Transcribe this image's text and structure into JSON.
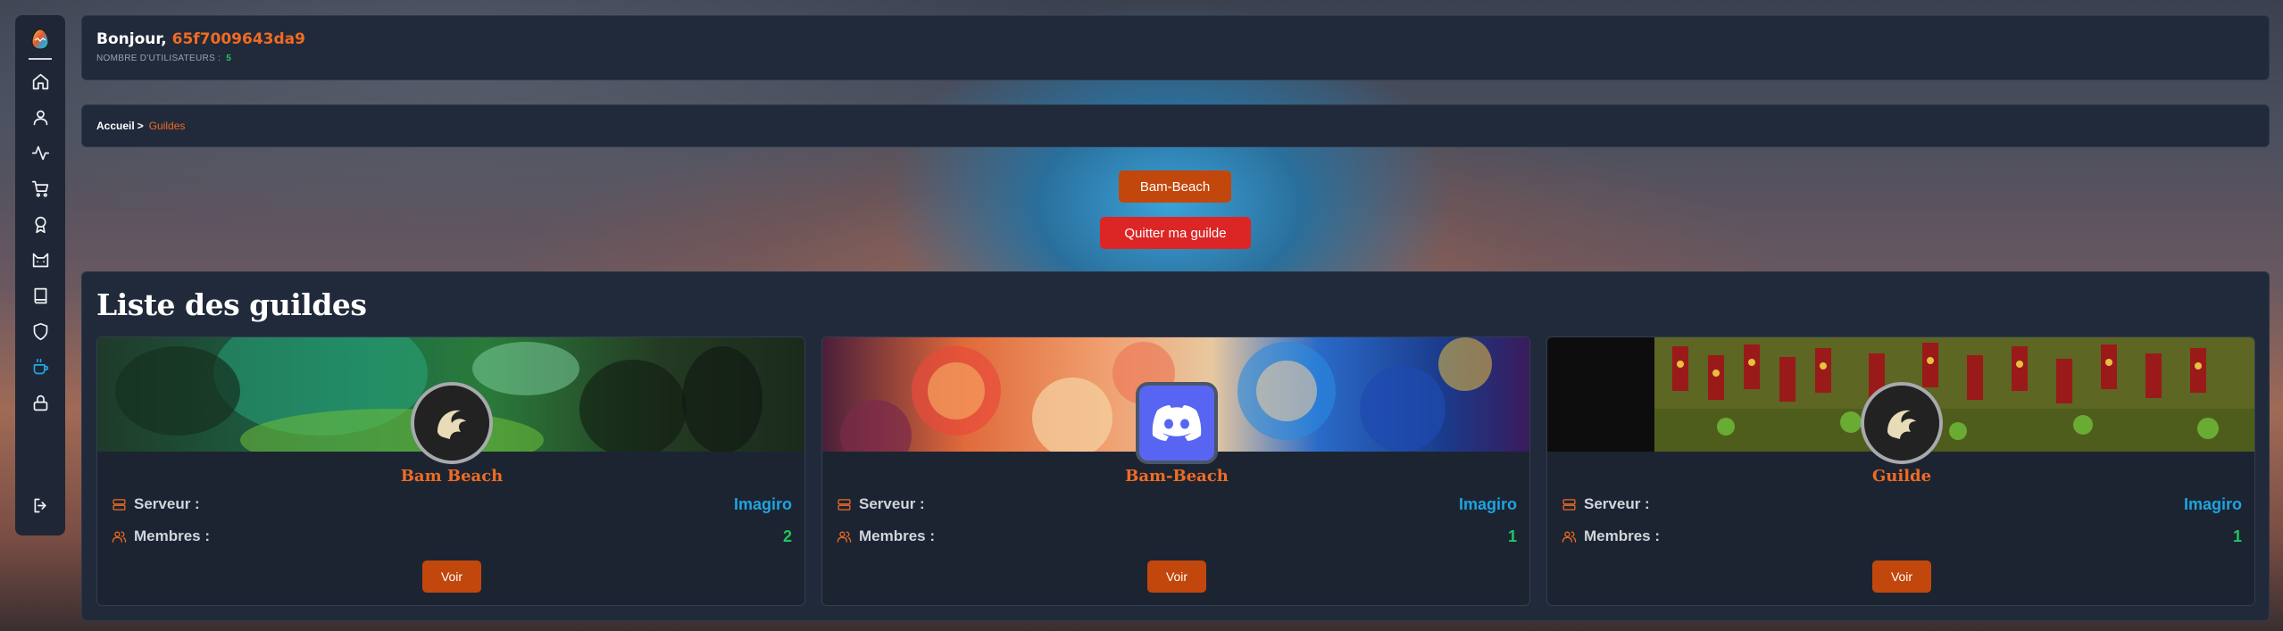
{
  "header": {
    "greeting": "Bonjour,",
    "username": "65f7009643da9",
    "users_label": "NOMBRE D'UTILISATEURS :",
    "users_count": "5"
  },
  "breadcrumb": {
    "home": "Accueil",
    "separator": ">",
    "current": "Guildes"
  },
  "actions": {
    "my_guild": "Bam-Beach",
    "quit": "Quitter ma guilde"
  },
  "guild_list": {
    "title": "Liste des guildes",
    "server_label": "Serveur :",
    "members_label": "Membres :",
    "view_label": "Voir",
    "guilds": [
      {
        "name": "Bam Beach",
        "server": "Imagiro",
        "members": "2",
        "avatar": "guild-emblem-icon",
        "banner": "jungle-banner"
      },
      {
        "name": "Bam-Beach",
        "server": "Imagiro",
        "members": "1",
        "avatar": "discord-icon",
        "banner": "swirl-art-banner"
      },
      {
        "name": "Guilde",
        "server": "Imagiro",
        "members": "1",
        "avatar": "guild-emblem-icon",
        "banner": "banners-crowd-banner"
      }
    ]
  },
  "sidebar": {
    "items": [
      "home-icon",
      "user-icon",
      "activity-icon",
      "cart-icon",
      "award-icon",
      "cat-icon",
      "book-icon",
      "shield-icon",
      "cup-icon",
      "lock-icon"
    ],
    "active": "cup-icon",
    "logout": "logout-icon"
  },
  "colors": {
    "accent": "#f06b22",
    "button": "#c2470c",
    "danger": "#dc2626",
    "server": "#1ea4e0",
    "members": "#22c55e",
    "panel": "#212a3a"
  }
}
